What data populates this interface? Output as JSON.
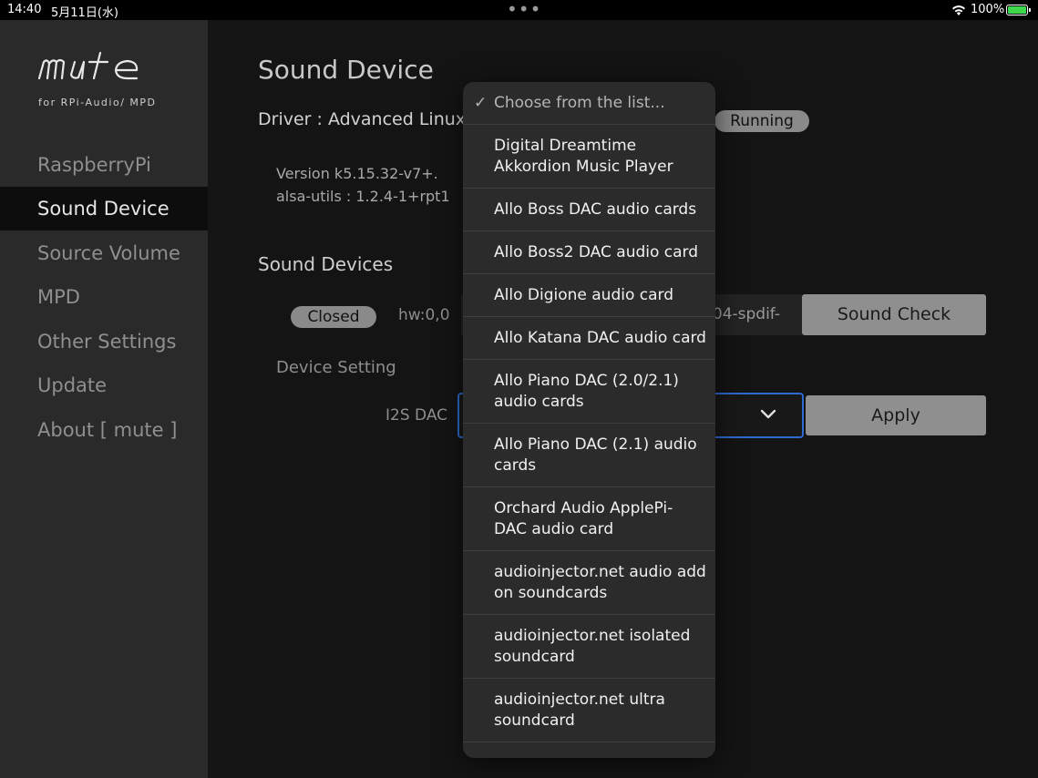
{
  "status_bar": {
    "time": "14:40",
    "date": "5月11日(水)",
    "dots": "•••",
    "battery_pct": "100%",
    "battery_color": "#3ed64a"
  },
  "sidebar": {
    "logo_sub": "for RPi-Audio/ MPD",
    "items": [
      {
        "label": "RaspberryPi",
        "active": false
      },
      {
        "label": "Sound Device",
        "active": true
      },
      {
        "label": "Source Volume",
        "active": false
      },
      {
        "label": "MPD",
        "active": false
      },
      {
        "label": "Other Settings",
        "active": false
      },
      {
        "label": "Update",
        "active": false
      },
      {
        "label": "About [ mute ]",
        "active": false
      }
    ]
  },
  "main": {
    "title": "Sound Device",
    "driver": "Driver : Advanced Linux",
    "running": "Running",
    "version_line1": "Version k5.15.32-v7+.",
    "version_line2": "alsa-utils : 1.2.4-1+rpt1",
    "sound_devices": "Sound Devices",
    "closed": "Closed",
    "hw": "hw:0,0",
    "device_value": "04-spdif-",
    "sound_check": "Sound Check",
    "device_setting": "Device Setting",
    "i2s_label": "I2S DAC",
    "apply": "Apply",
    "focus_color": "#2d6bd0"
  },
  "dropdown": {
    "selected": "Choose from the list...",
    "options": [
      [
        "Digital Dreamtime",
        "Akkordion Music Player"
      ],
      [
        "Allo Boss DAC audio cards"
      ],
      [
        "Allo Boss2 DAC audio card"
      ],
      [
        "Allo Digione audio card"
      ],
      [
        "Allo Katana DAC audio card"
      ],
      [
        "Allo Piano DAC (2.0/2.1)",
        "audio cards"
      ],
      [
        "Allo Piano DAC (2.1) audio",
        "cards"
      ],
      [
        "Orchard Audio ApplePi-",
        "DAC audio card"
      ],
      [
        "audioinjector.net audio add",
        "on soundcards"
      ],
      [
        "audioinjector.net isolated",
        "soundcard"
      ],
      [
        "audioinjector.net ultra",
        "soundcard"
      ]
    ]
  }
}
